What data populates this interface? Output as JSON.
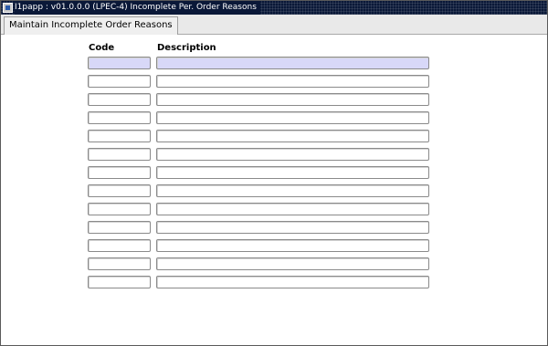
{
  "window": {
    "title": "I1papp : v01.0.0.0 (LPEC-4) Incomplete Per. Order Reasons"
  },
  "tabs": [
    {
      "label": "Maintain Incomplete Order Reasons"
    }
  ],
  "table": {
    "headers": {
      "code": "Code",
      "description": "Description"
    },
    "rows": [
      {
        "code": "",
        "description": ""
      },
      {
        "code": "",
        "description": ""
      },
      {
        "code": "",
        "description": ""
      },
      {
        "code": "",
        "description": ""
      },
      {
        "code": "",
        "description": ""
      },
      {
        "code": "",
        "description": ""
      },
      {
        "code": "",
        "description": ""
      },
      {
        "code": "",
        "description": ""
      },
      {
        "code": "",
        "description": ""
      },
      {
        "code": "",
        "description": ""
      },
      {
        "code": "",
        "description": ""
      },
      {
        "code": "",
        "description": ""
      },
      {
        "code": "",
        "description": ""
      }
    ]
  },
  "colors": {
    "titlebar": "#0a1838",
    "active_field": "#d8d8f8"
  }
}
